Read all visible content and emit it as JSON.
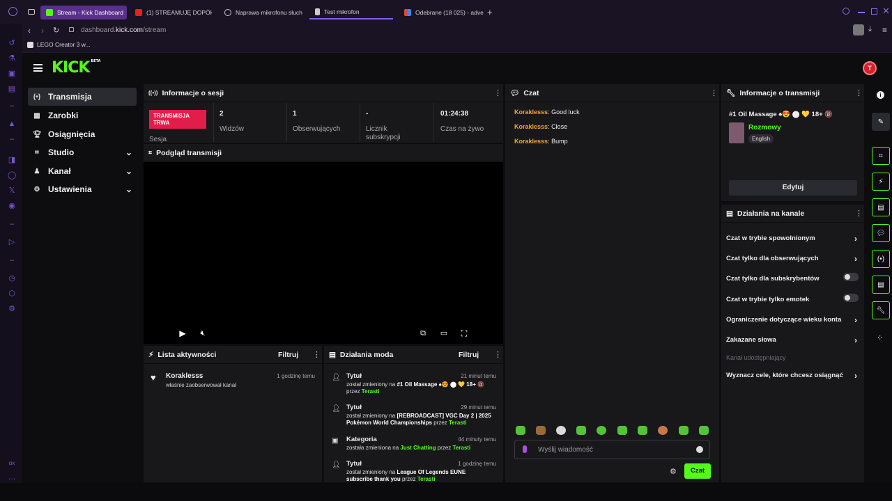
{
  "browser": {
    "tabs": [
      {
        "label": "Stream - Kick Dashboard",
        "active": true
      },
      {
        "label": "(1) STREAMUJĘ DOPÓKI"
      },
      {
        "label": "Naprawa mikrofonu słuch"
      },
      {
        "label": "Test mikrofon"
      },
      {
        "label": "Odebrane (18 025) - adve"
      }
    ],
    "url_host": "dashboard.",
    "url_domain": "kick.com",
    "url_path": "/stream",
    "bookmark": "LEGO Creator 3 w..."
  },
  "sidebar": {
    "items": [
      {
        "label": "Transmisja"
      },
      {
        "label": "Zarobki"
      },
      {
        "label": "Osiągnięcia"
      },
      {
        "label": "Studio"
      },
      {
        "label": "Kanał"
      },
      {
        "label": "Ustawienia"
      }
    ]
  },
  "session": {
    "title": "Informacje o sesji",
    "live_badge": "TRANSMISJA TRWA",
    "session_label": "Sesja",
    "stats": [
      {
        "value": "2",
        "label": "Widzów"
      },
      {
        "value": "1",
        "label": "Obserwujących"
      },
      {
        "value": "-",
        "label": "Licznik subskrypcji"
      },
      {
        "value": "01:24:38",
        "label": "Czas na żywo"
      }
    ]
  },
  "preview": {
    "title": "Podgląd transmisji"
  },
  "activity": {
    "title": "Lista aktywności",
    "filter": "Filtruj",
    "items": [
      {
        "user": "Koraklesss",
        "desc": "właśnie zaobserwował kanał",
        "time": "1 godzinę temu"
      }
    ]
  },
  "modactions": {
    "title": "Działania moda",
    "filter": "Filtruj",
    "items": [
      {
        "title": "Tytuł",
        "time": "21 minut temu",
        "pre": "został zmieniony na ",
        "value": "#1 Oil Massage ♠😍 ⬤ 💛 18+ 🔞",
        "by": "przez ",
        "user": "Terasti"
      },
      {
        "title": "Tytuł",
        "time": "29 minut temu",
        "pre": "został zmieniony na ",
        "value": "[REBROADCAST] VGC Day 2 | 2025 Pokémon World Championships",
        "by": " przez ",
        "user": "Terasti"
      },
      {
        "title": "Kategoria",
        "time": "44 minuty temu",
        "pre": "została zmieniona na ",
        "value": "Just Chatting",
        "by": " przez ",
        "user": "Terasti"
      },
      {
        "title": "Tytuł",
        "time": "1 godzinę temu",
        "pre": "został zmieniony na ",
        "value": "League Of Legends EUNE subscribe thank you",
        "by": " przez ",
        "user": "Terasti"
      }
    ]
  },
  "chat": {
    "title": "Czat",
    "messages": [
      {
        "user": "Koraklesss",
        "text": "Good luck"
      },
      {
        "user": "Koraklesss",
        "text": "Close"
      },
      {
        "user": "Koraklesss",
        "text": "Bump"
      }
    ],
    "input_placeholder": "Wyślij wiadomość",
    "send_label": "Czat"
  },
  "streaminfo": {
    "title": "Informacje o transmisji",
    "stream_title": "#1 Oil Massage ♠😍 ⬤ 💛 18+ 🔞",
    "category": "Rozmowy",
    "language": "English",
    "edit_label": "Edytuj"
  },
  "channelactions": {
    "title": "Działania na kanale",
    "rows": [
      {
        "label": "Czat w trybie spowolnionym"
      },
      {
        "label": "Czat tylko dla obserwujących"
      },
      {
        "label": "Czat tylko dla subskrybentów"
      },
      {
        "label": "Czat w trybie tylko emotek"
      },
      {
        "label": "Ograniczenie dotyczące wieku konta"
      },
      {
        "label": "Zakazane słowa"
      },
      {
        "label": "Kanał udostępniający"
      },
      {
        "label": "Wyznacz cele, które chcesz osiągnąć"
      }
    ]
  },
  "colors": {
    "accent": "#53fc18",
    "live": "#e21d4a",
    "username": "#f2a33a"
  }
}
